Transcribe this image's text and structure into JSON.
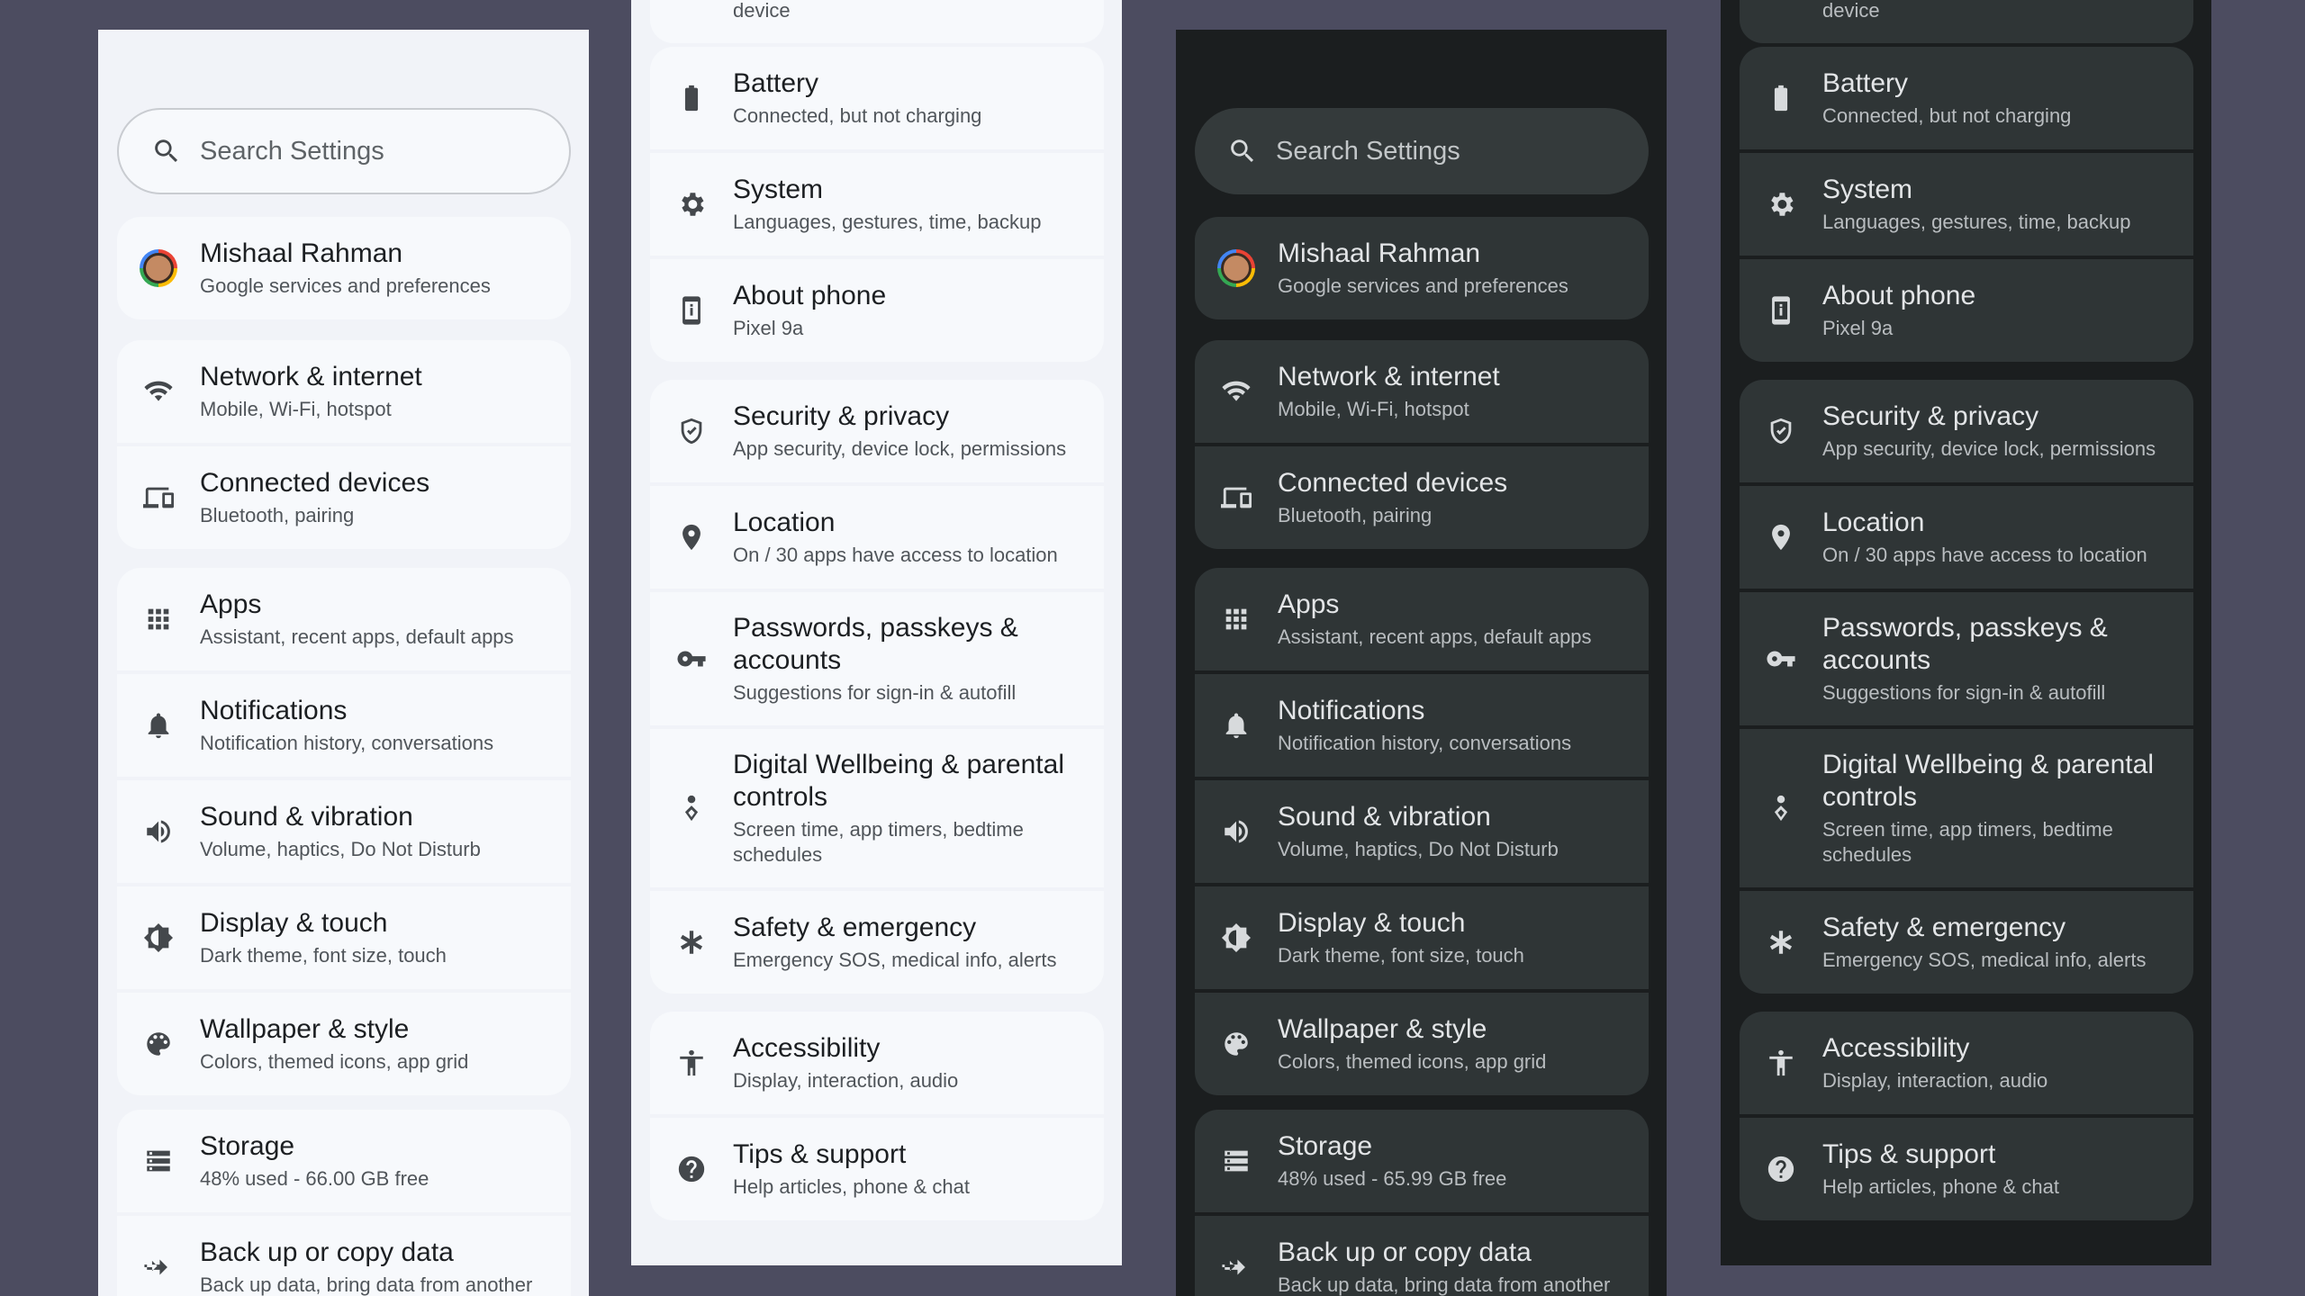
{
  "search": {
    "placeholder": "Search Settings"
  },
  "account": {
    "name": "Mishaal Rahman",
    "subtitle": "Google services and preferences"
  },
  "network": {
    "title": "Network & internet",
    "subtitle": "Mobile, Wi-Fi, hotspot"
  },
  "connected": {
    "title": "Connected devices",
    "subtitle": "Bluetooth, pairing"
  },
  "apps": {
    "title": "Apps",
    "subtitle": "Assistant, recent apps, default apps"
  },
  "notifications": {
    "title": "Notifications",
    "subtitle": "Notification history, conversations"
  },
  "sound": {
    "title": "Sound & vibration",
    "subtitle": "Volume, haptics, Do Not Disturb"
  },
  "display": {
    "title": "Display & touch",
    "subtitle": "Dark theme, font size, touch"
  },
  "wallpaper": {
    "title": "Wallpaper & style",
    "subtitle": "Colors, themed icons, app grid"
  },
  "storage": {
    "title": "Storage",
    "subtitle_light": "48% used - 66.00 GB free",
    "subtitle_dark": "48% used - 65.99 GB free"
  },
  "backup": {
    "title": "Back up or copy data",
    "subtitle": "Back up data, bring data from another"
  },
  "device_cut": "device",
  "battery": {
    "title": "Battery",
    "subtitle": "Connected, but not charging"
  },
  "system": {
    "title": "System",
    "subtitle": "Languages, gestures, time, backup"
  },
  "about": {
    "title": "About phone",
    "subtitle": "Pixel 9a"
  },
  "security": {
    "title": "Security & privacy",
    "subtitle": "App security, device lock, permissions"
  },
  "location": {
    "title": "Location",
    "subtitle": "On / 30 apps have access to location"
  },
  "passwords": {
    "title": "Passwords, passkeys & accounts",
    "subtitle": "Suggestions for sign-in & autofill"
  },
  "wellbeing": {
    "title": "Digital Wellbeing & parental controls",
    "subtitle": "Screen time, app timers, bedtime schedules"
  },
  "safety": {
    "title": "Safety & emergency",
    "subtitle": "Emergency SOS, medical info, alerts"
  },
  "accessibility": {
    "title": "Accessibility",
    "subtitle": "Display, interaction, audio"
  },
  "tips": {
    "title": "Tips & support",
    "subtitle": "Help articles, phone & chat"
  },
  "colors": {
    "background": "#4c4c60",
    "light_panel": "#f1f3f8",
    "dark_panel": "#1b1e1f",
    "light_card": "#f7f9fc",
    "dark_card": "#2f3536"
  }
}
